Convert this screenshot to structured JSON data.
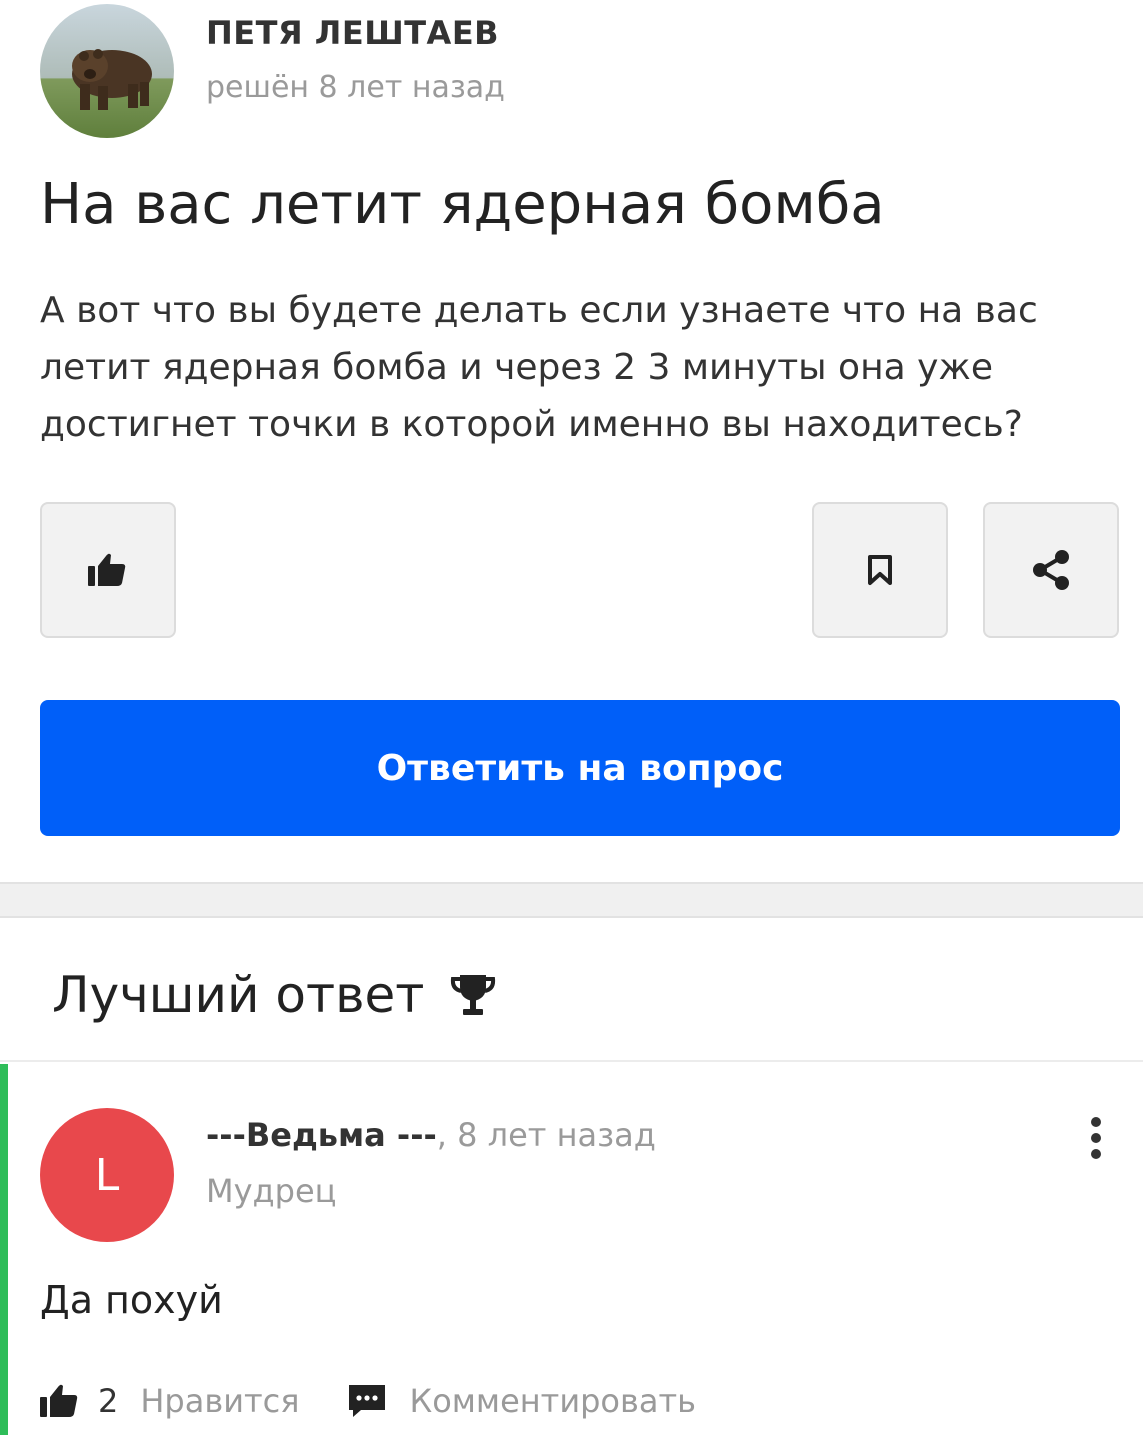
{
  "question": {
    "author_name": "ПЕТЯ ЛЕШТАЕВ",
    "author_meta": "решён 8 лет назад",
    "title": "На вас летит ядерная бомба",
    "body": "А вот что вы будете делать если узнаете что на вас летит ядерная бомба и через 2 3 минуты она уже достигнет точки в которой именно вы находитесь?",
    "answer_button": "Ответить на вопрос",
    "icons": {
      "like": "thumbs-up-icon",
      "bookmark": "bookmark-icon",
      "share": "share-icon"
    }
  },
  "best_answer": {
    "header": "Лучший ответ",
    "header_icon": "trophy-icon",
    "avatar_letter": "L",
    "author": "---Ведьма ---",
    "time": "8 лет назад",
    "rank": "Мудрец",
    "text": "Да похуй",
    "like_count": "2",
    "like_label": "Нравится",
    "comment_label": "Комментировать",
    "accent_color": "#2ebd59"
  },
  "colors": {
    "primary_button": "#005ff9",
    "avatar_bg": "#e8484c",
    "muted_text": "#9a9a9a"
  }
}
